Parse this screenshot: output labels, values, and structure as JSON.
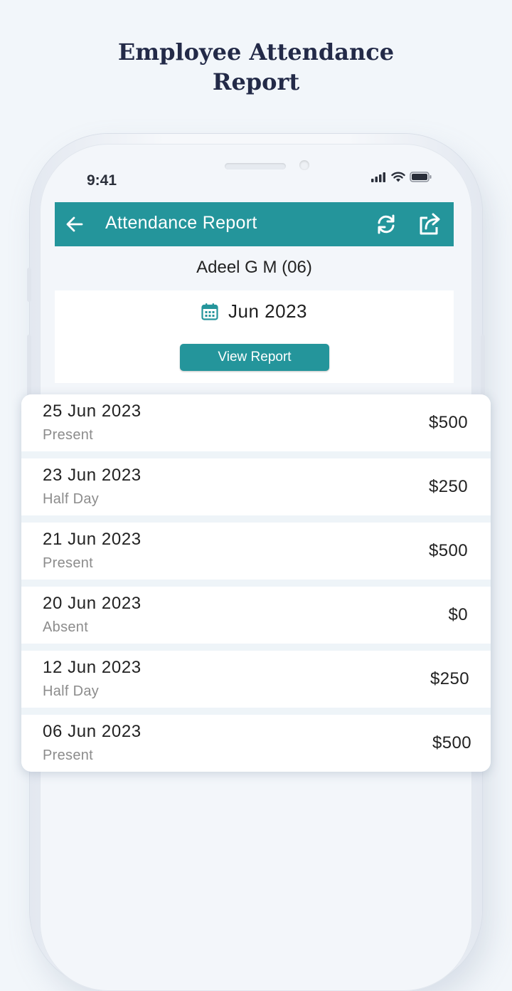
{
  "headline": {
    "line1": "Employee Attendance",
    "line2": "Report"
  },
  "status_bar": {
    "time": "9:41"
  },
  "app_bar": {
    "title": "Attendance Report"
  },
  "employee": {
    "name": "Adeel G M (06)"
  },
  "filter": {
    "month": "Jun 2023",
    "button_label": "View Report"
  },
  "records": [
    {
      "date": "25 Jun 2023",
      "status": "Present",
      "amount": "$500"
    },
    {
      "date": "23 Jun 2023",
      "status": "Half Day",
      "amount": "$250"
    },
    {
      "date": "21 Jun 2023",
      "status": "Present",
      "amount": "$500"
    },
    {
      "date": "20 Jun 2023",
      "status": "Absent",
      "amount": "$0"
    },
    {
      "date": "12 Jun 2023",
      "status": "Half Day",
      "amount": "$250"
    },
    {
      "date": "06 Jun 2023",
      "status": "Present",
      "amount": "$500"
    }
  ],
  "colors": {
    "accent": "#24959b",
    "headline": "#232a48",
    "background": "#f2f6fa"
  },
  "icons": [
    "back-arrow-icon",
    "refresh-icon",
    "share-icon",
    "calendar-icon",
    "signal-icon",
    "wifi-icon",
    "battery-icon"
  ]
}
